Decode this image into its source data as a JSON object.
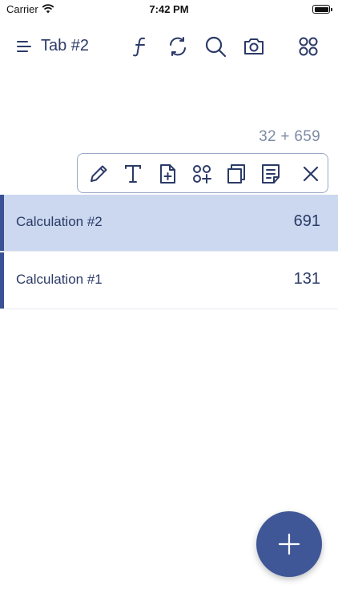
{
  "status": {
    "carrier": "Carrier",
    "time": "7:42 PM"
  },
  "header": {
    "tab_title": "Tab #2",
    "icons": [
      "menu-icon",
      "function-icon",
      "refresh-icon",
      "search-icon",
      "camera-icon",
      "apps-icon"
    ]
  },
  "expression": "32 + 659",
  "toolbar": {
    "icons": [
      "pencil-icon",
      "text-icon",
      "new-document-icon",
      "add-grid-icon",
      "copy-icon",
      "note-icon",
      "close-icon"
    ]
  },
  "calculations": [
    {
      "label": "Calculation #2",
      "value": "691",
      "selected": true
    },
    {
      "label": "Calculation #1",
      "value": "131",
      "selected": false
    }
  ],
  "colors": {
    "primary": "#3f5797",
    "text": "#2b3a67",
    "selected_row": "#cbd8ef",
    "muted": "#7f8ba5"
  },
  "fab": {
    "icon": "plus-icon"
  }
}
